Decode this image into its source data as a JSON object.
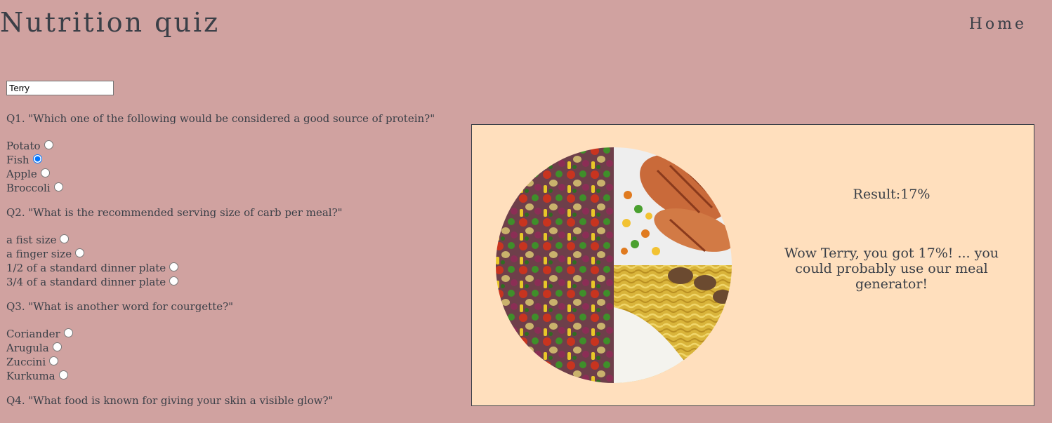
{
  "header": {
    "title": "Nutrition quiz",
    "nav_home": "Home"
  },
  "name_input": {
    "value": "Terry"
  },
  "questions": [
    {
      "text": "Q1. \"Which one of the following would be considered a good source of protein?\"",
      "options": [
        "Potato",
        "Fish",
        "Apple",
        "Broccoli"
      ],
      "selected": "Fish"
    },
    {
      "text": "Q2. \"What is the recommended serving size of carb per meal?\"",
      "options": [
        "a fist size",
        "a finger size",
        "1/2 of a standard dinner plate",
        "3/4 of a standard dinner plate"
      ]
    },
    {
      "text": "Q3. \"What is another word for courgette?\"",
      "options": [
        "Coriander",
        "Arugula",
        "Zuccini",
        "Kurkuma"
      ]
    },
    {
      "text": "Q4. \"What food is known for giving your skin a visible glow?\""
    }
  ],
  "result": {
    "score": "Result:17%",
    "message": "Wow Terry, you got 17%! ... you could probably use our meal generator!"
  },
  "colors": {
    "page_background": "#d0a2a0",
    "panel_background": "#ffdfbd",
    "text": "#3a3f47",
    "radio_selected": "#1a73e8"
  }
}
